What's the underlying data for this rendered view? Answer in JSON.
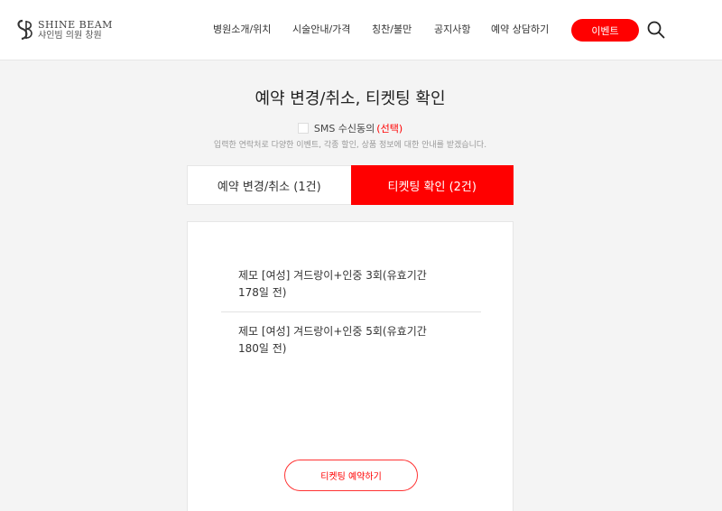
{
  "header": {
    "logo_en": "SHINE BEAM",
    "logo_ko": "샤인빔 의원 창원",
    "nav": [
      {
        "label": "병원소개/위치"
      },
      {
        "label": "시술안내/가격"
      },
      {
        "label": "칭찬/불만"
      },
      {
        "label": "공지사항"
      },
      {
        "label": "예약 상담하기"
      }
    ],
    "event_label": "이벤트",
    "search_icon": "search-icon"
  },
  "page": {
    "title": "예약 변경/취소, 티켓팅 확인",
    "sms_label": "SMS 수신동의",
    "sms_optional": "(선택)",
    "notice": "입력한 연락처로 다양한 이벤트, 각종 할인, 상품 정보에 대한 안내를 받겠습니다."
  },
  "tabs": [
    {
      "label": "예약 변경/취소 (1건)",
      "active": false
    },
    {
      "label": "티켓팅 확인 (2건)",
      "active": true
    }
  ],
  "tickets": [
    {
      "name": "제모 [여성] 겨드랑이+인중 3회(유효기간",
      "date": "178일 전)"
    },
    {
      "name": "제모 [여성] 겨드랑이+인중 5회(유효기간",
      "date": "180일 전)"
    }
  ],
  "reserve_button": "티켓팅 예약하기",
  "colors": {
    "accent": "#ff0000",
    "background": "#f4f4f4"
  }
}
